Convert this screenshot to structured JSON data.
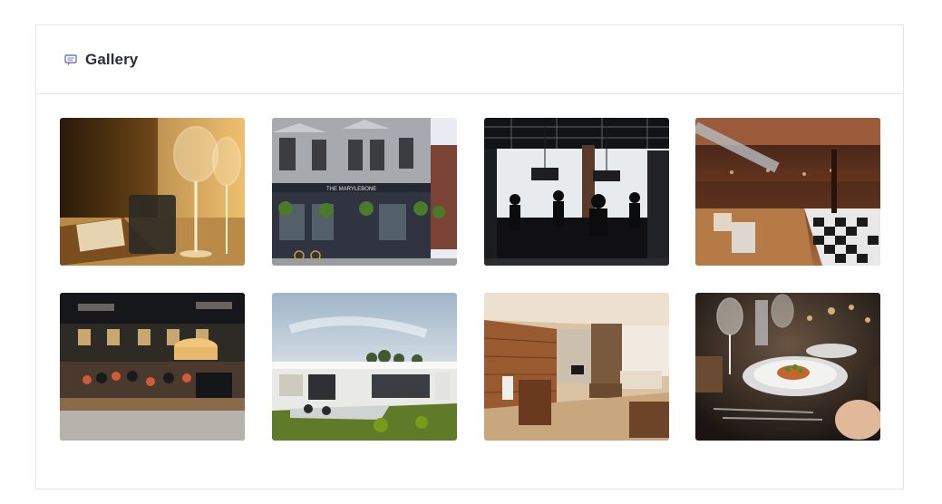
{
  "gallery": {
    "title": "Gallery",
    "header_icon": "chat-icon",
    "images": [
      {
        "name": "wine-glasses-table",
        "alt": "Wine glasses on a dining table"
      },
      {
        "name": "marylebone-pub",
        "alt": "The Marylebone pub exterior",
        "sign": "THE MARYLEBONE"
      },
      {
        "name": "industrial-bar-interior",
        "alt": "Industrial bar interior"
      },
      {
        "name": "wood-floor-restaurant",
        "alt": "Restaurant with wooden floor"
      },
      {
        "name": "busy-bar-counter",
        "alt": "Busy bar counter"
      },
      {
        "name": "modern-house-exterior",
        "alt": "Modern house exterior"
      },
      {
        "name": "office-living-interior",
        "alt": "Living room interior"
      },
      {
        "name": "plated-dinner",
        "alt": "Plated dinner with wine glasses"
      }
    ]
  }
}
